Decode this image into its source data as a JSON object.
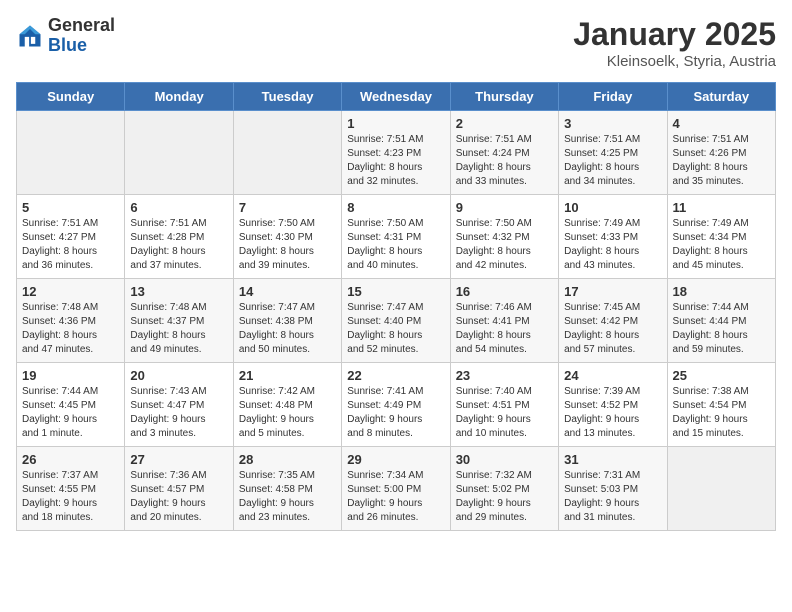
{
  "logo": {
    "general": "General",
    "blue": "Blue"
  },
  "title": "January 2025",
  "location": "Kleinsoelk, Styria, Austria",
  "days_of_week": [
    "Sunday",
    "Monday",
    "Tuesday",
    "Wednesday",
    "Thursday",
    "Friday",
    "Saturday"
  ],
  "weeks": [
    [
      {
        "day": "",
        "info": ""
      },
      {
        "day": "",
        "info": ""
      },
      {
        "day": "",
        "info": ""
      },
      {
        "day": "1",
        "info": "Sunrise: 7:51 AM\nSunset: 4:23 PM\nDaylight: 8 hours\nand 32 minutes."
      },
      {
        "day": "2",
        "info": "Sunrise: 7:51 AM\nSunset: 4:24 PM\nDaylight: 8 hours\nand 33 minutes."
      },
      {
        "day": "3",
        "info": "Sunrise: 7:51 AM\nSunset: 4:25 PM\nDaylight: 8 hours\nand 34 minutes."
      },
      {
        "day": "4",
        "info": "Sunrise: 7:51 AM\nSunset: 4:26 PM\nDaylight: 8 hours\nand 35 minutes."
      }
    ],
    [
      {
        "day": "5",
        "info": "Sunrise: 7:51 AM\nSunset: 4:27 PM\nDaylight: 8 hours\nand 36 minutes."
      },
      {
        "day": "6",
        "info": "Sunrise: 7:51 AM\nSunset: 4:28 PM\nDaylight: 8 hours\nand 37 minutes."
      },
      {
        "day": "7",
        "info": "Sunrise: 7:50 AM\nSunset: 4:30 PM\nDaylight: 8 hours\nand 39 minutes."
      },
      {
        "day": "8",
        "info": "Sunrise: 7:50 AM\nSunset: 4:31 PM\nDaylight: 8 hours\nand 40 minutes."
      },
      {
        "day": "9",
        "info": "Sunrise: 7:50 AM\nSunset: 4:32 PM\nDaylight: 8 hours\nand 42 minutes."
      },
      {
        "day": "10",
        "info": "Sunrise: 7:49 AM\nSunset: 4:33 PM\nDaylight: 8 hours\nand 43 minutes."
      },
      {
        "day": "11",
        "info": "Sunrise: 7:49 AM\nSunset: 4:34 PM\nDaylight: 8 hours\nand 45 minutes."
      }
    ],
    [
      {
        "day": "12",
        "info": "Sunrise: 7:48 AM\nSunset: 4:36 PM\nDaylight: 8 hours\nand 47 minutes."
      },
      {
        "day": "13",
        "info": "Sunrise: 7:48 AM\nSunset: 4:37 PM\nDaylight: 8 hours\nand 49 minutes."
      },
      {
        "day": "14",
        "info": "Sunrise: 7:47 AM\nSunset: 4:38 PM\nDaylight: 8 hours\nand 50 minutes."
      },
      {
        "day": "15",
        "info": "Sunrise: 7:47 AM\nSunset: 4:40 PM\nDaylight: 8 hours\nand 52 minutes."
      },
      {
        "day": "16",
        "info": "Sunrise: 7:46 AM\nSunset: 4:41 PM\nDaylight: 8 hours\nand 54 minutes."
      },
      {
        "day": "17",
        "info": "Sunrise: 7:45 AM\nSunset: 4:42 PM\nDaylight: 8 hours\nand 57 minutes."
      },
      {
        "day": "18",
        "info": "Sunrise: 7:44 AM\nSunset: 4:44 PM\nDaylight: 8 hours\nand 59 minutes."
      }
    ],
    [
      {
        "day": "19",
        "info": "Sunrise: 7:44 AM\nSunset: 4:45 PM\nDaylight: 9 hours\nand 1 minute."
      },
      {
        "day": "20",
        "info": "Sunrise: 7:43 AM\nSunset: 4:47 PM\nDaylight: 9 hours\nand 3 minutes."
      },
      {
        "day": "21",
        "info": "Sunrise: 7:42 AM\nSunset: 4:48 PM\nDaylight: 9 hours\nand 5 minutes."
      },
      {
        "day": "22",
        "info": "Sunrise: 7:41 AM\nSunset: 4:49 PM\nDaylight: 9 hours\nand 8 minutes."
      },
      {
        "day": "23",
        "info": "Sunrise: 7:40 AM\nSunset: 4:51 PM\nDaylight: 9 hours\nand 10 minutes."
      },
      {
        "day": "24",
        "info": "Sunrise: 7:39 AM\nSunset: 4:52 PM\nDaylight: 9 hours\nand 13 minutes."
      },
      {
        "day": "25",
        "info": "Sunrise: 7:38 AM\nSunset: 4:54 PM\nDaylight: 9 hours\nand 15 minutes."
      }
    ],
    [
      {
        "day": "26",
        "info": "Sunrise: 7:37 AM\nSunset: 4:55 PM\nDaylight: 9 hours\nand 18 minutes."
      },
      {
        "day": "27",
        "info": "Sunrise: 7:36 AM\nSunset: 4:57 PM\nDaylight: 9 hours\nand 20 minutes."
      },
      {
        "day": "28",
        "info": "Sunrise: 7:35 AM\nSunset: 4:58 PM\nDaylight: 9 hours\nand 23 minutes."
      },
      {
        "day": "29",
        "info": "Sunrise: 7:34 AM\nSunset: 5:00 PM\nDaylight: 9 hours\nand 26 minutes."
      },
      {
        "day": "30",
        "info": "Sunrise: 7:32 AM\nSunset: 5:02 PM\nDaylight: 9 hours\nand 29 minutes."
      },
      {
        "day": "31",
        "info": "Sunrise: 7:31 AM\nSunset: 5:03 PM\nDaylight: 9 hours\nand 31 minutes."
      },
      {
        "day": "",
        "info": ""
      }
    ]
  ]
}
